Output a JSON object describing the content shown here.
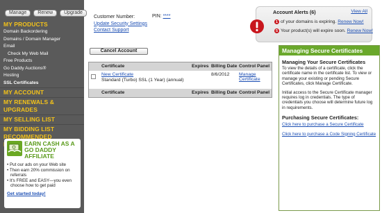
{
  "top_buttons": [
    "Manage",
    "Renew",
    "Upgrade"
  ],
  "sidebar": {
    "products_heading": "MY PRODUCTS",
    "items": [
      {
        "label": "Domain Backordering",
        "sub": false,
        "active": false
      },
      {
        "label": "Domains / Domain Manager",
        "sub": false,
        "active": false
      },
      {
        "label": "Email",
        "sub": false,
        "active": false
      },
      {
        "label": "Check My Web Mail",
        "sub": true,
        "active": false
      },
      {
        "label": "Free Products",
        "sub": false,
        "active": false
      },
      {
        "label": "Go Daddy Auctions®",
        "sub": false,
        "active": false
      },
      {
        "label": "Hosting",
        "sub": false,
        "active": false
      },
      {
        "label": "SSL Certificates",
        "sub": false,
        "active": true
      }
    ],
    "headings": [
      "MY ACCOUNT",
      "MY RENEWALS & UPGRADES",
      "MY SELLING LIST",
      "MY BIDDING LIST",
      "RECOMMENDED PRODUCTS"
    ]
  },
  "affiliate": {
    "title_line1": "EARN CASH AS A",
    "title_line2": "GO DADDY AFFILIATE",
    "bullets": [
      "• Put our ads on your Web site",
      "• Then earn 20% commission on referrals",
      "• It's FREE and EASY—you even choose how to get paid"
    ],
    "cta": "Get started today!"
  },
  "header": {
    "customer_number_label": "Customer Number:",
    "update_security": "Update Security Settings",
    "contact_support": "Contact Support",
    "pin_label": "PIN:",
    "pin_value": "****"
  },
  "alerts": {
    "title": "Account Alerts (6)",
    "view_all": "View All",
    "rows": [
      {
        "num": "1",
        "text": "of your domains is expiring.",
        "link": "Renew Now!"
      },
      {
        "num": "5",
        "text": "Your product(s) will expire soon.",
        "link": "Renew Now!"
      }
    ]
  },
  "cancel_button": "Cancel Account",
  "table": {
    "headers": [
      "Certificate",
      "Expires",
      "Billing Date",
      "Control Panel"
    ],
    "rows": [
      {
        "name": "New Certificate",
        "desc": "Standard (Turbo) SSL (1 Year) (annual)",
        "expires": "",
        "billing": "8/6/2012",
        "control": "Manage Certificate"
      }
    ]
  },
  "panel": {
    "heading": "Managing Secure Certificates",
    "section1_title": "Managing Your Secure Certificates",
    "section1_text": "To view the details of a certificate, click the certificate name in the certificate list. To view or manage your existing or pending Secure Certificates, click Manage Certificate.",
    "section1_text2": "Initial access to the Secure Certificate manager requires log in credentials. The type of credentials you choose will determine future log in requirements.",
    "section2_title": "Purchasing Secure Certificates:",
    "link1": "Click here to purchase a Secure Certificate",
    "link2": "Click here to purchase a Code Signing Certificate"
  },
  "colors": {
    "sidebar_bg": "#5a5a5a",
    "heading_yellow": "#f3c21a",
    "panel_green": "#6aa82b",
    "link_blue": "#1a4db3",
    "alert_red": "#c8161d"
  }
}
